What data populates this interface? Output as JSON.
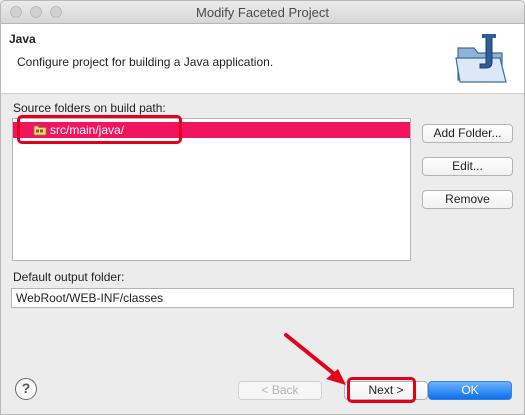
{
  "window": {
    "title": "Modify Faceted Project"
  },
  "banner": {
    "title": "Java",
    "description": "Configure project for building a Java application.",
    "icon": "java-folder-icon"
  },
  "source_folders": {
    "label": "Source folders on build path:",
    "items": [
      {
        "label": "src/main/java/",
        "icon": "package-folder-icon",
        "selected": true
      }
    ]
  },
  "side_buttons": {
    "add_folder": "Add Folder...",
    "edit": "Edit...",
    "remove": "Remove"
  },
  "output": {
    "label": "Default output folder:",
    "value": "WebRoot/WEB-INF/classes"
  },
  "footer": {
    "help": "?",
    "back": "< Back",
    "next": "Next >",
    "ok": "OK"
  },
  "colors": {
    "selection": "#f0155e",
    "annotation": "#e3001b",
    "primary_button": "#0b6ff0"
  }
}
